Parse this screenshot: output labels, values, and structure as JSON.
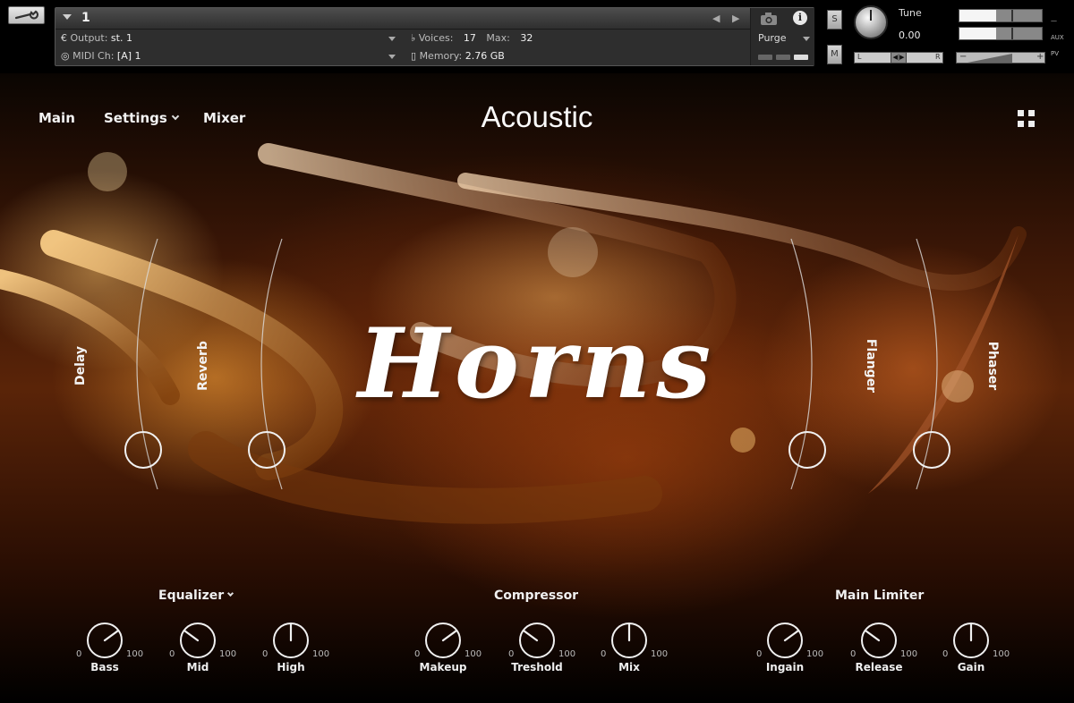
{
  "header": {
    "instrument_number": "1",
    "output_label": "Output:",
    "output_value": "st. 1",
    "midi_label": "MIDI Ch:",
    "midi_value": "[A]  1",
    "voices_label": "Voices:",
    "voices_value": "17",
    "max_label": "Max:",
    "max_value": "32",
    "memory_label": "Memory:",
    "memory_value": "2.76 GB",
    "purge_label": "Purge",
    "solo_label": "S",
    "mute_label": "M",
    "tune_label": "Tune",
    "tune_value": "0.00",
    "pan_left": "L",
    "pan_right": "R",
    "pan_mid": "◀|▶",
    "vol_minus": "−",
    "vol_plus": "+",
    "aux_label": "AUX",
    "pv_label": "PV",
    "dash": "—",
    "arrow_left": "◀",
    "arrow_right": "▶",
    "meter_top_fill": 0.45,
    "meter_bottom_fill": 0.45
  },
  "nav": {
    "main": "Main",
    "settings": "Settings",
    "mixer": "Mixer"
  },
  "title": "Acoustic",
  "logo": "Horns",
  "fx": {
    "delay": "Delay",
    "reverb": "Reverb",
    "flanger": "Flanger",
    "phaser": "Phaser"
  },
  "sections": {
    "equalizer": "Equalizer",
    "compressor": "Compressor",
    "limiter": "Main Limiter"
  },
  "knobs": {
    "min": "0",
    "max": "100",
    "items": [
      {
        "label": "Bass",
        "value": 70
      },
      {
        "label": "Mid",
        "value": 30
      },
      {
        "label": "High",
        "value": 50
      },
      {
        "label": "Makeup",
        "value": 70
      },
      {
        "label": "Treshold",
        "value": 30
      },
      {
        "label": "Mix",
        "value": 50
      },
      {
        "label": "Ingain",
        "value": 70
      },
      {
        "label": "Release",
        "value": 30
      },
      {
        "label": "Gain",
        "value": 50
      }
    ]
  },
  "colors": {
    "accent": "#f0f0f0",
    "background": "#000000"
  }
}
